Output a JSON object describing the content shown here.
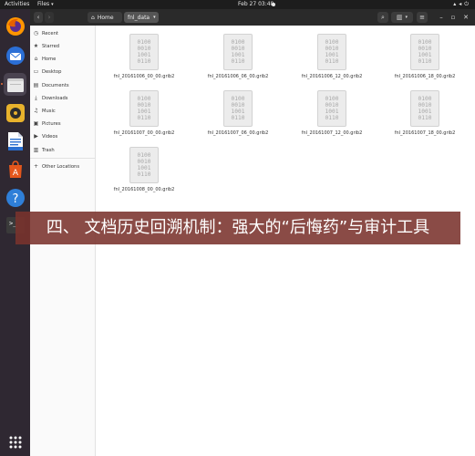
{
  "topbar": {
    "activities": "Activities",
    "app_menu": "Files",
    "clock": "Feb 27  03:48"
  },
  "dock": {
    "items": [
      {
        "name": "firefox-icon",
        "color": "#e66000"
      },
      {
        "name": "thunderbird-icon",
        "color": "#2b6fd6"
      },
      {
        "name": "files-icon",
        "color": "#9a9a9a",
        "active": true
      },
      {
        "name": "rhythmbox-icon",
        "color": "#e8b22c"
      },
      {
        "name": "libreoffice-writer-icon",
        "color": "#2a6fd0"
      },
      {
        "name": "ubuntu-software-icon",
        "color": "#e4571c"
      },
      {
        "name": "help-icon",
        "color": "#2f7fd8"
      },
      {
        "name": "terminal-icon",
        "color": "#3a3a3a"
      },
      {
        "name": "show-applications-icon",
        "color": "#ffffff"
      }
    ]
  },
  "header": {
    "breadcrumb_home": "Home",
    "breadcrumb_current": "fnl_data"
  },
  "sidebar": {
    "items": [
      {
        "label": "Recent",
        "icon": "recent-icon",
        "glyph": "◷"
      },
      {
        "label": "Starred",
        "icon": "star-icon",
        "glyph": "★"
      },
      {
        "label": "Home",
        "icon": "home-icon",
        "glyph": "⌂"
      },
      {
        "label": "Desktop",
        "icon": "desktop-icon",
        "glyph": "▭"
      },
      {
        "label": "Documents",
        "icon": "documents-icon",
        "glyph": "▤"
      },
      {
        "label": "Downloads",
        "icon": "downloads-icon",
        "glyph": "⤓"
      },
      {
        "label": "Music",
        "icon": "music-icon",
        "glyph": "♫"
      },
      {
        "label": "Pictures",
        "icon": "pictures-icon",
        "glyph": "▣"
      },
      {
        "label": "Videos",
        "icon": "videos-icon",
        "glyph": "▶"
      },
      {
        "label": "Trash",
        "icon": "trash-icon",
        "glyph": "🗑"
      }
    ],
    "other": {
      "label": "Other Locations",
      "icon": "plus-icon",
      "glyph": "+"
    }
  },
  "files": [
    {
      "name": "fnl_20161006_00_00.grib2"
    },
    {
      "name": "fnl_20161006_06_00.grib2"
    },
    {
      "name": "fnl_20161006_12_00.grib2"
    },
    {
      "name": "fnl_20161006_18_00.grib2"
    },
    {
      "name": "fnl_20161007_00_00.grib2"
    },
    {
      "name": "fnl_20161007_06_00.grib2"
    },
    {
      "name": "fnl_20161007_12_00.grib2"
    },
    {
      "name": "fnl_20161007_18_00.grib2"
    },
    {
      "name": "fnl_20161008_00_00.grib2"
    }
  ],
  "file_icon_lines": [
    "0100",
    "0010",
    "1001",
    "0110"
  ],
  "banner": {
    "text": "四、 文档历史回溯机制：强大的“后悔药”与审计工具"
  }
}
